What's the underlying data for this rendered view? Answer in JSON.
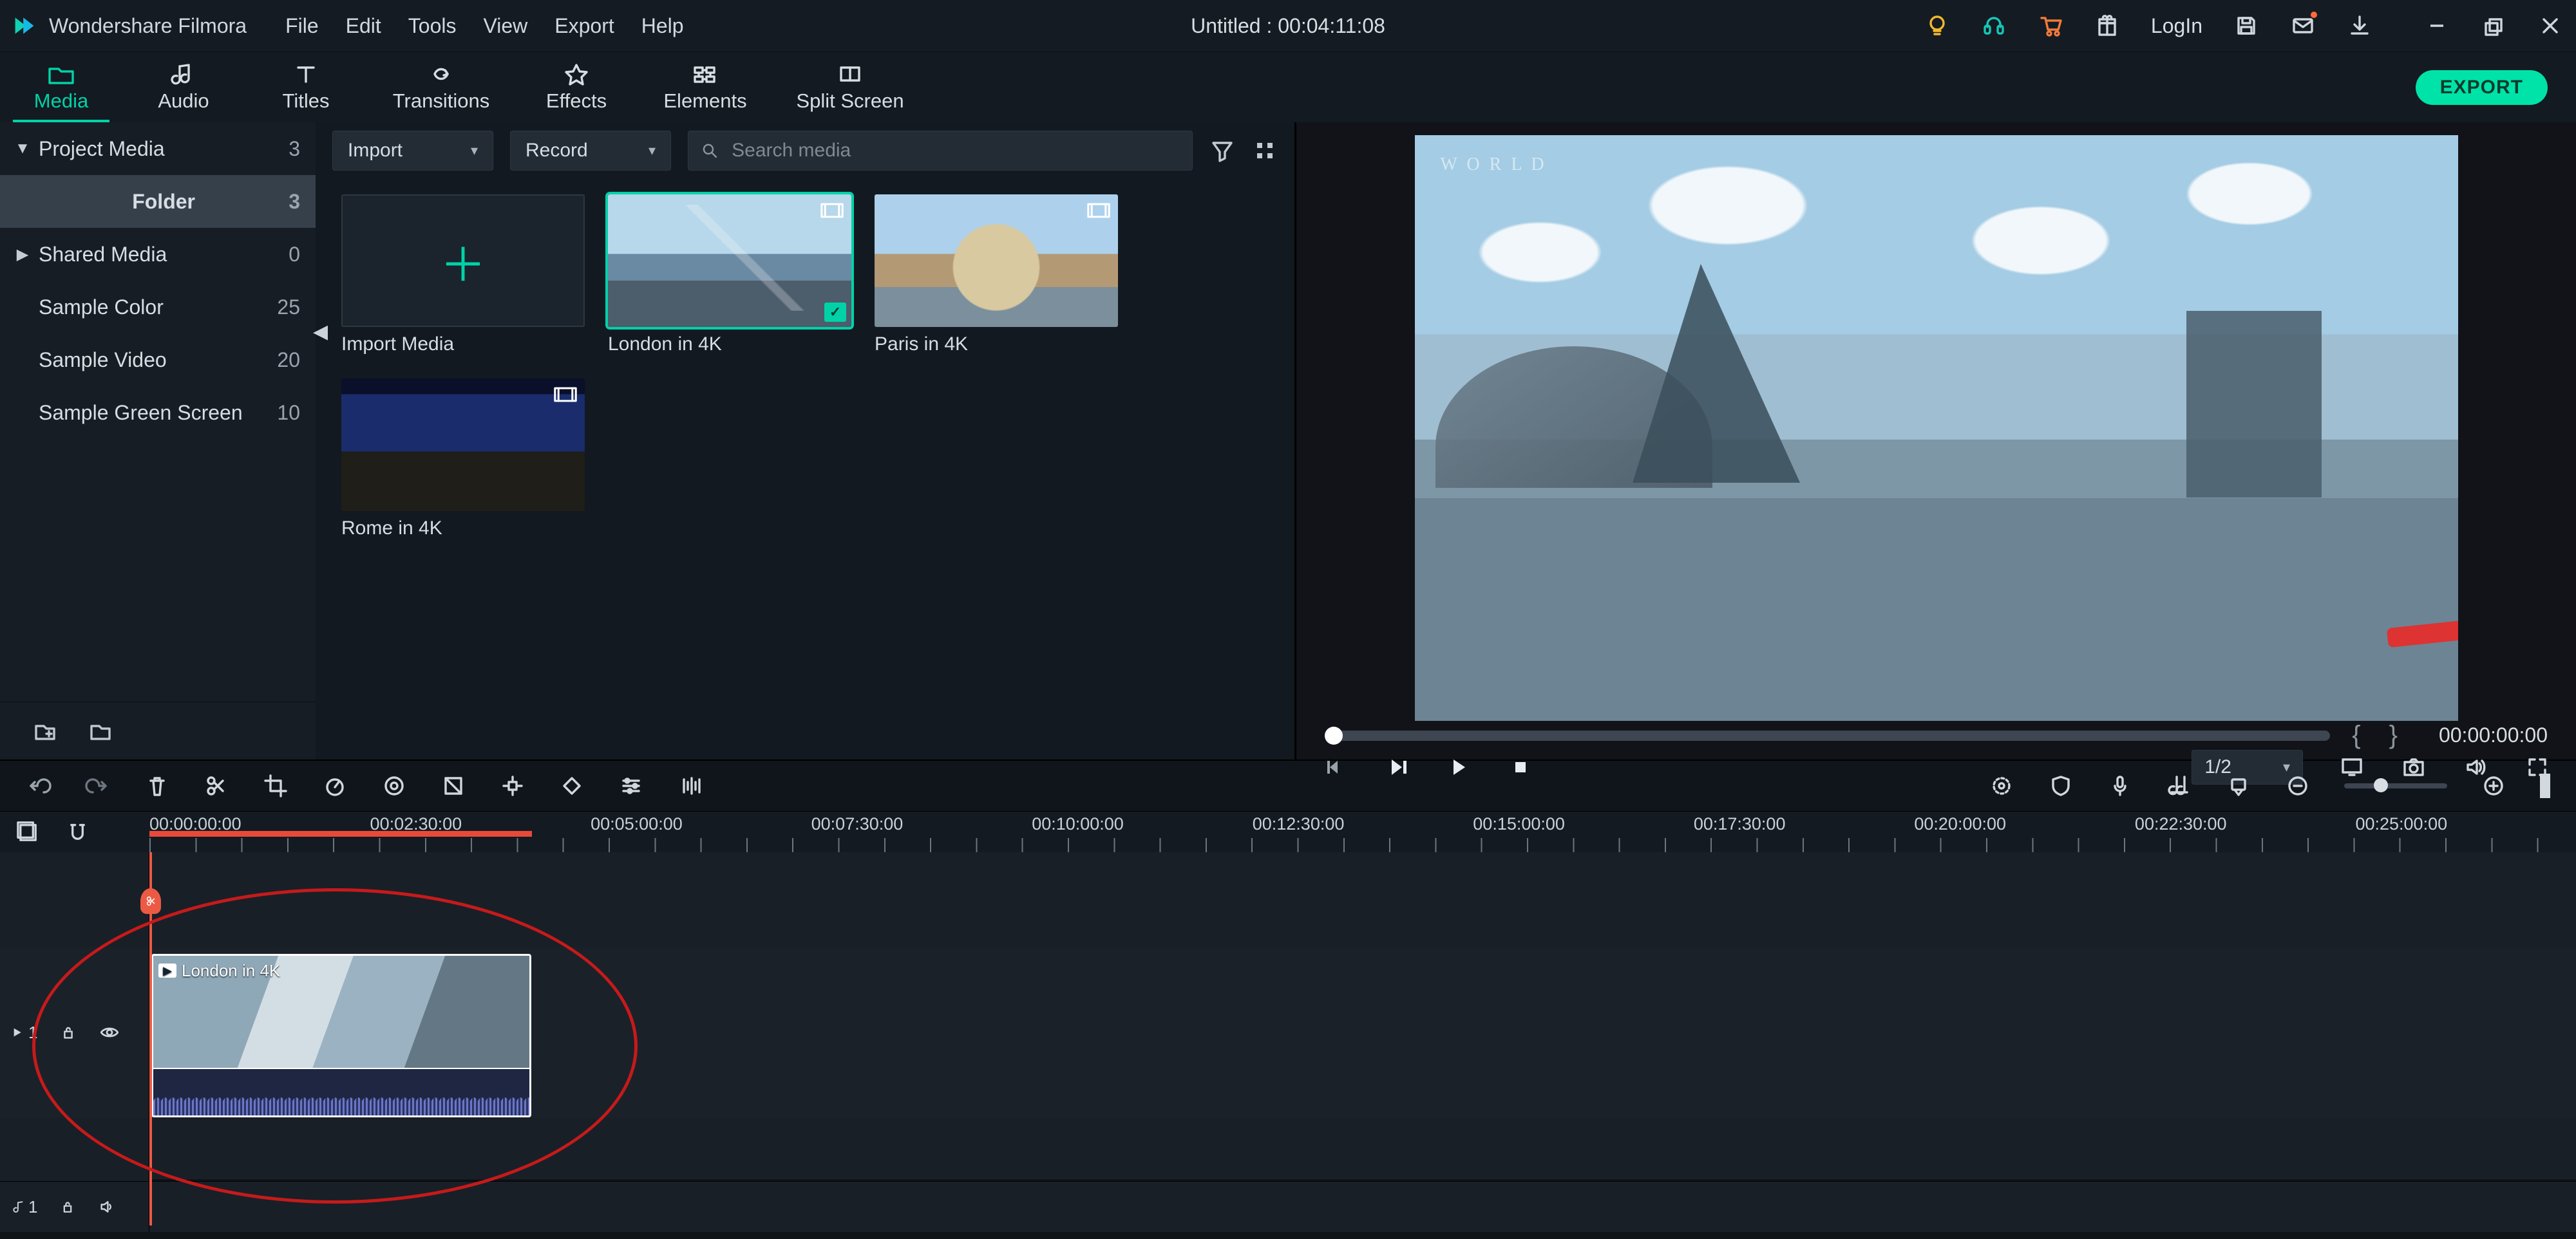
{
  "app": {
    "name": "Wondershare Filmora"
  },
  "menu": [
    "File",
    "Edit",
    "Tools",
    "View",
    "Export",
    "Help"
  ],
  "title": "Untitled : 00:04:11:08",
  "login_label": "LogIn",
  "tabs": [
    {
      "label": "Media",
      "active": true
    },
    {
      "label": "Audio"
    },
    {
      "label": "Titles"
    },
    {
      "label": "Transitions"
    },
    {
      "label": "Effects"
    },
    {
      "label": "Elements"
    },
    {
      "label": "Split Screen"
    }
  ],
  "export_label": "EXPORT",
  "sidebar": {
    "items": [
      {
        "label": "Project Media",
        "count": "3",
        "expanded": true
      },
      {
        "label": "Folder",
        "count": "3",
        "selected": true
      },
      {
        "label": "Shared Media",
        "count": "0",
        "expandable": true
      },
      {
        "label": "Sample Color",
        "count": "25"
      },
      {
        "label": "Sample Video",
        "count": "20"
      },
      {
        "label": "Sample Green Screen",
        "count": "10"
      }
    ]
  },
  "mediabar": {
    "import_label": "Import",
    "record_label": "Record",
    "search_placeholder": "Search media"
  },
  "media_items": [
    {
      "caption": "Import Media",
      "type": "import"
    },
    {
      "caption": "London in 4K",
      "type": "video",
      "selected": true
    },
    {
      "caption": "Paris in 4K",
      "type": "video"
    },
    {
      "caption": "Rome in 4K",
      "type": "video"
    }
  ],
  "preview": {
    "watermark_line1": "W O R L D",
    "timecode": "00:00:00:00",
    "quality": "1/2"
  },
  "timeline": {
    "ruler": [
      "00:00:00:00",
      "00:02:30:00",
      "00:05:00:00",
      "00:07:30:00",
      "00:10:00:00",
      "00:12:30:00",
      "00:15:00:00",
      "00:17:30:00",
      "00:20:00:00",
      "00:22:30:00",
      "00:25:00:00"
    ],
    "video_track_label": "1",
    "audio_track_label": "1",
    "clip": {
      "title": "London in 4K"
    }
  }
}
